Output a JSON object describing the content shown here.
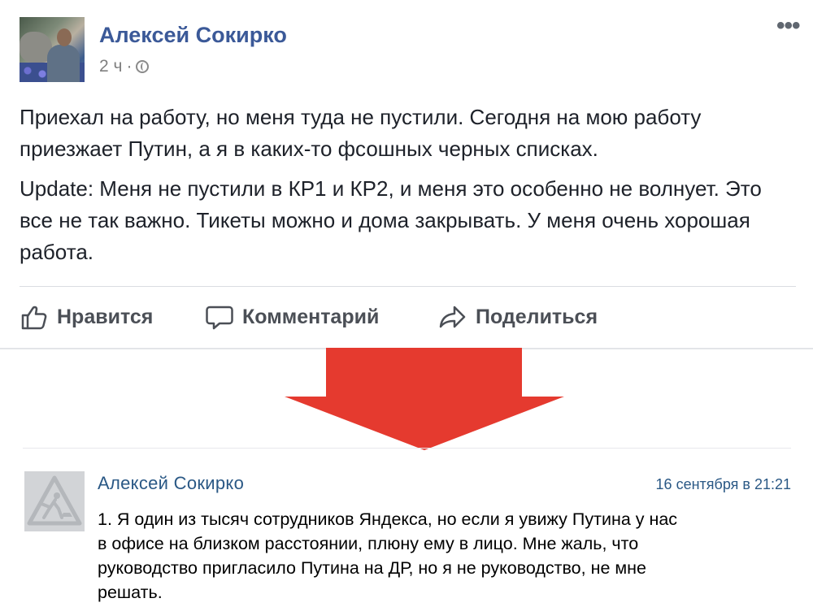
{
  "fb_post": {
    "author": "Алексей Сокирко",
    "time": "2 ч",
    "separator": "·",
    "paragraphs": [
      "Приехал на работу, но меня туда не пустили. Сегодня на мою работу приезжает Путин, а я в каких-то фсошных черных списках.",
      "Update: Меня не пустили в КР1 и КР2, и меня это особенно не волнует. Это все не так важно. Тикеты можно и дома закрывать. У меня очень хорошая работа."
    ],
    "actions": {
      "like": "Нравится",
      "comment": "Комментарий",
      "share": "Поделиться"
    },
    "more_icon": "•••"
  },
  "arrow": {
    "color": "#e53a2f",
    "icon": "down-arrow"
  },
  "vk_post": {
    "author": "Алексей Сокирко",
    "date": "16 сентября в 21:21",
    "text": "1. Я один из тысяч сотрудников Яндекса, но если я увижу Путина у нас\nв офисе на близком расстоянии, плюну ему в лицо. Мне жаль, что\nруководство пригласило Путина на ДР, но я не руководство, не мне\nрешать."
  },
  "colors": {
    "fb_name": "#3b5998",
    "vk_link": "#2a5885",
    "action_text": "#4b4f56"
  }
}
